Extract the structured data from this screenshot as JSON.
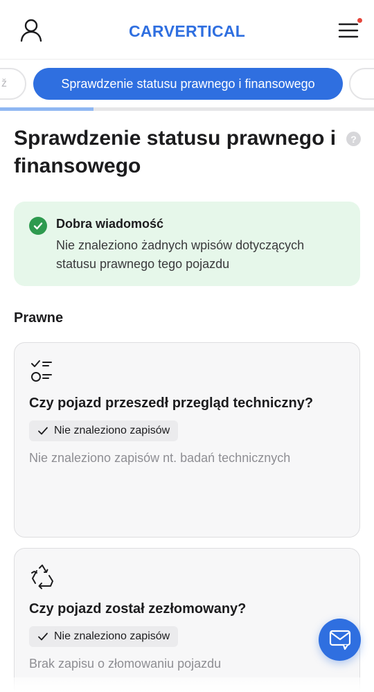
{
  "header": {
    "logo_text_left": "CAR",
    "logo_text_v": "V",
    "logo_text_right": "ERTICAL",
    "icons": {
      "user": "user-icon",
      "menu": "hamburger-menu-icon"
    },
    "notification_color": "#e5463b"
  },
  "tabs": {
    "active_label": "Sprawdzenie statusu prawnego i finansowego",
    "left_glyph": "ž",
    "progress_fraction": 0.25
  },
  "page": {
    "title": "Sprawdzenie statusu prawnego i finansowego",
    "help_glyph": "?"
  },
  "alert": {
    "title": "Dobra wiadomość",
    "body": "Nie znaleziono żadnych wpisów dotyczących statusu prawnego tego pojazdu",
    "icon": "check-circle-icon"
  },
  "section": {
    "title": "Prawne"
  },
  "cards": [
    {
      "icon": "checklist-icon",
      "title": "Czy pojazd przeszedł przegląd techniczny?",
      "badge": "Nie znaleziono zapisów",
      "description": "Nie znaleziono zapisów nt. badań technicznych"
    },
    {
      "icon": "recycle-icon",
      "title": "Czy pojazd został zezłomowany?",
      "badge": "Nie znaleziono zapisów",
      "description": "Brak zapisu o złomowaniu pojazdu"
    }
  ],
  "chat": {
    "icon": "chat-icon"
  },
  "colors": {
    "accent": "#2f6fe0",
    "success": "#2e9a4f",
    "success_bg": "#e6f7ea"
  }
}
